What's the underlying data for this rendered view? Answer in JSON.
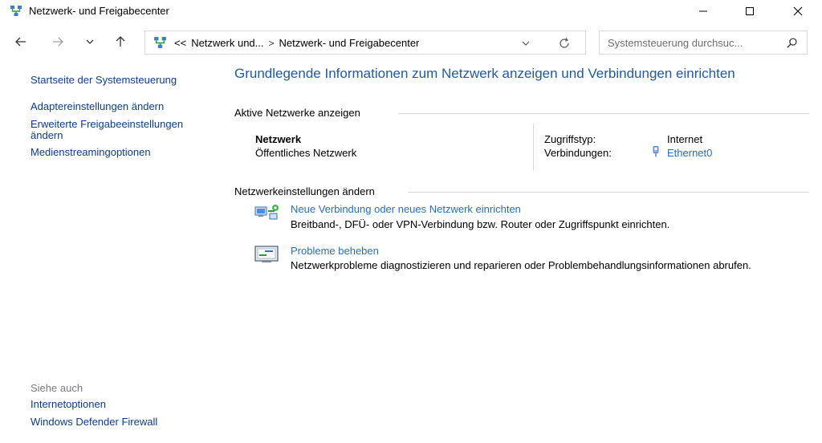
{
  "window": {
    "title": "Netzwerk- und Freigabecenter"
  },
  "address": {
    "overflow": "<<",
    "crumb1": "Netzwerk und...",
    "separator": ">",
    "crumb2": "Netzwerk- und Freigabecenter"
  },
  "search": {
    "placeholder": "Systemsteuerung durchsuc..."
  },
  "sidebar": {
    "items": [
      {
        "label": "Startseite der Systemsteuerung"
      },
      {
        "label": "Adaptereinstellungen ändern"
      },
      {
        "label": "Erweiterte Freigabeeinstellungen ändern"
      },
      {
        "label": "Medienstreamingoptionen"
      }
    ],
    "see_also_label": "Siehe auch",
    "see_also": [
      {
        "label": "Internetoptionen"
      },
      {
        "label": "Windows Defender Firewall"
      }
    ]
  },
  "main": {
    "heading": "Grundlegende Informationen zum Netzwerk anzeigen und Verbindungen einrichten",
    "active_section": "Aktive Netzwerke anzeigen",
    "network": {
      "name": "Netzwerk",
      "profile": "Öffentliches Netzwerk",
      "access_label": "Zugriffstyp:",
      "access_value": "Internet",
      "connections_label": "Verbindungen:",
      "connection": "Ethernet0"
    },
    "settings_section": "Netzwerkeinstellungen ändern",
    "tasks": [
      {
        "title": "Neue Verbindung oder neues Netzwerk einrichten",
        "description": "Breitband-, DFÜ- oder VPN-Verbindung bzw. Router oder Zugriffspunkt einrichten."
      },
      {
        "title": "Probleme beheben",
        "description": "Netzwerkprobleme diagnostizieren und reparieren oder Problembehandlungsinformationen abrufen."
      }
    ]
  },
  "colors": {
    "heading": "#1e5aa8",
    "link": "#1e6fd0",
    "nav_link": "#0f3b8c"
  }
}
